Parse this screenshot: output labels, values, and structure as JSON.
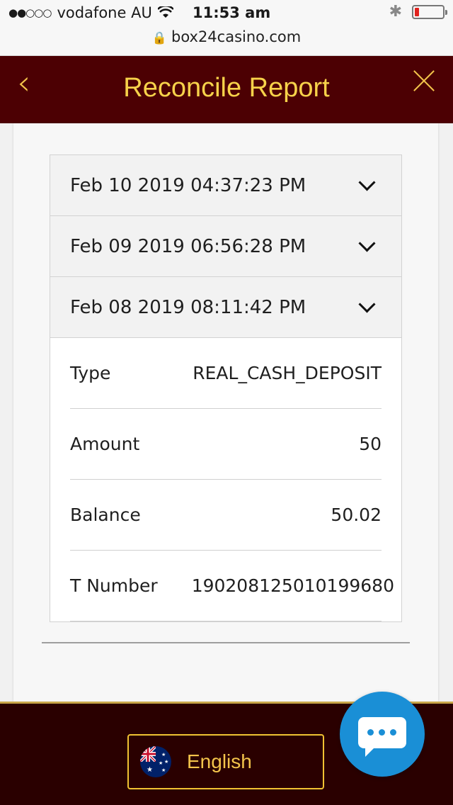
{
  "status_bar": {
    "carrier": "vodafone AU",
    "time": "11:53 am",
    "url": "box24casino.com",
    "battery_level": 0.15,
    "battery_color": "#e0231f"
  },
  "header": {
    "title": "Reconcile Report",
    "back_icon": "chevron-left-icon",
    "close_icon": "close-icon",
    "bg_color": "#4c0003",
    "accent_color": "#f7d24a"
  },
  "report": {
    "entries": [
      {
        "date": "Feb 10 2019 04:37:23 PM",
        "expanded": false
      },
      {
        "date": "Feb 09 2019 06:56:28 PM",
        "expanded": false
      },
      {
        "date": "Feb 08 2019 08:11:42 PM",
        "expanded": true
      }
    ],
    "details": [
      {
        "label": "Type",
        "value": "REAL_CASH_DEPOSIT"
      },
      {
        "label": "Amount",
        "value": "50"
      },
      {
        "label": "Balance",
        "value": "50.02"
      },
      {
        "label": "T Number",
        "value": "190208125010199680"
      }
    ]
  },
  "footer": {
    "language": "English",
    "flag_icon": "australia-flag-icon",
    "chat_icon": "chat-bubble-icon",
    "chat_color": "#1a8fd6"
  }
}
